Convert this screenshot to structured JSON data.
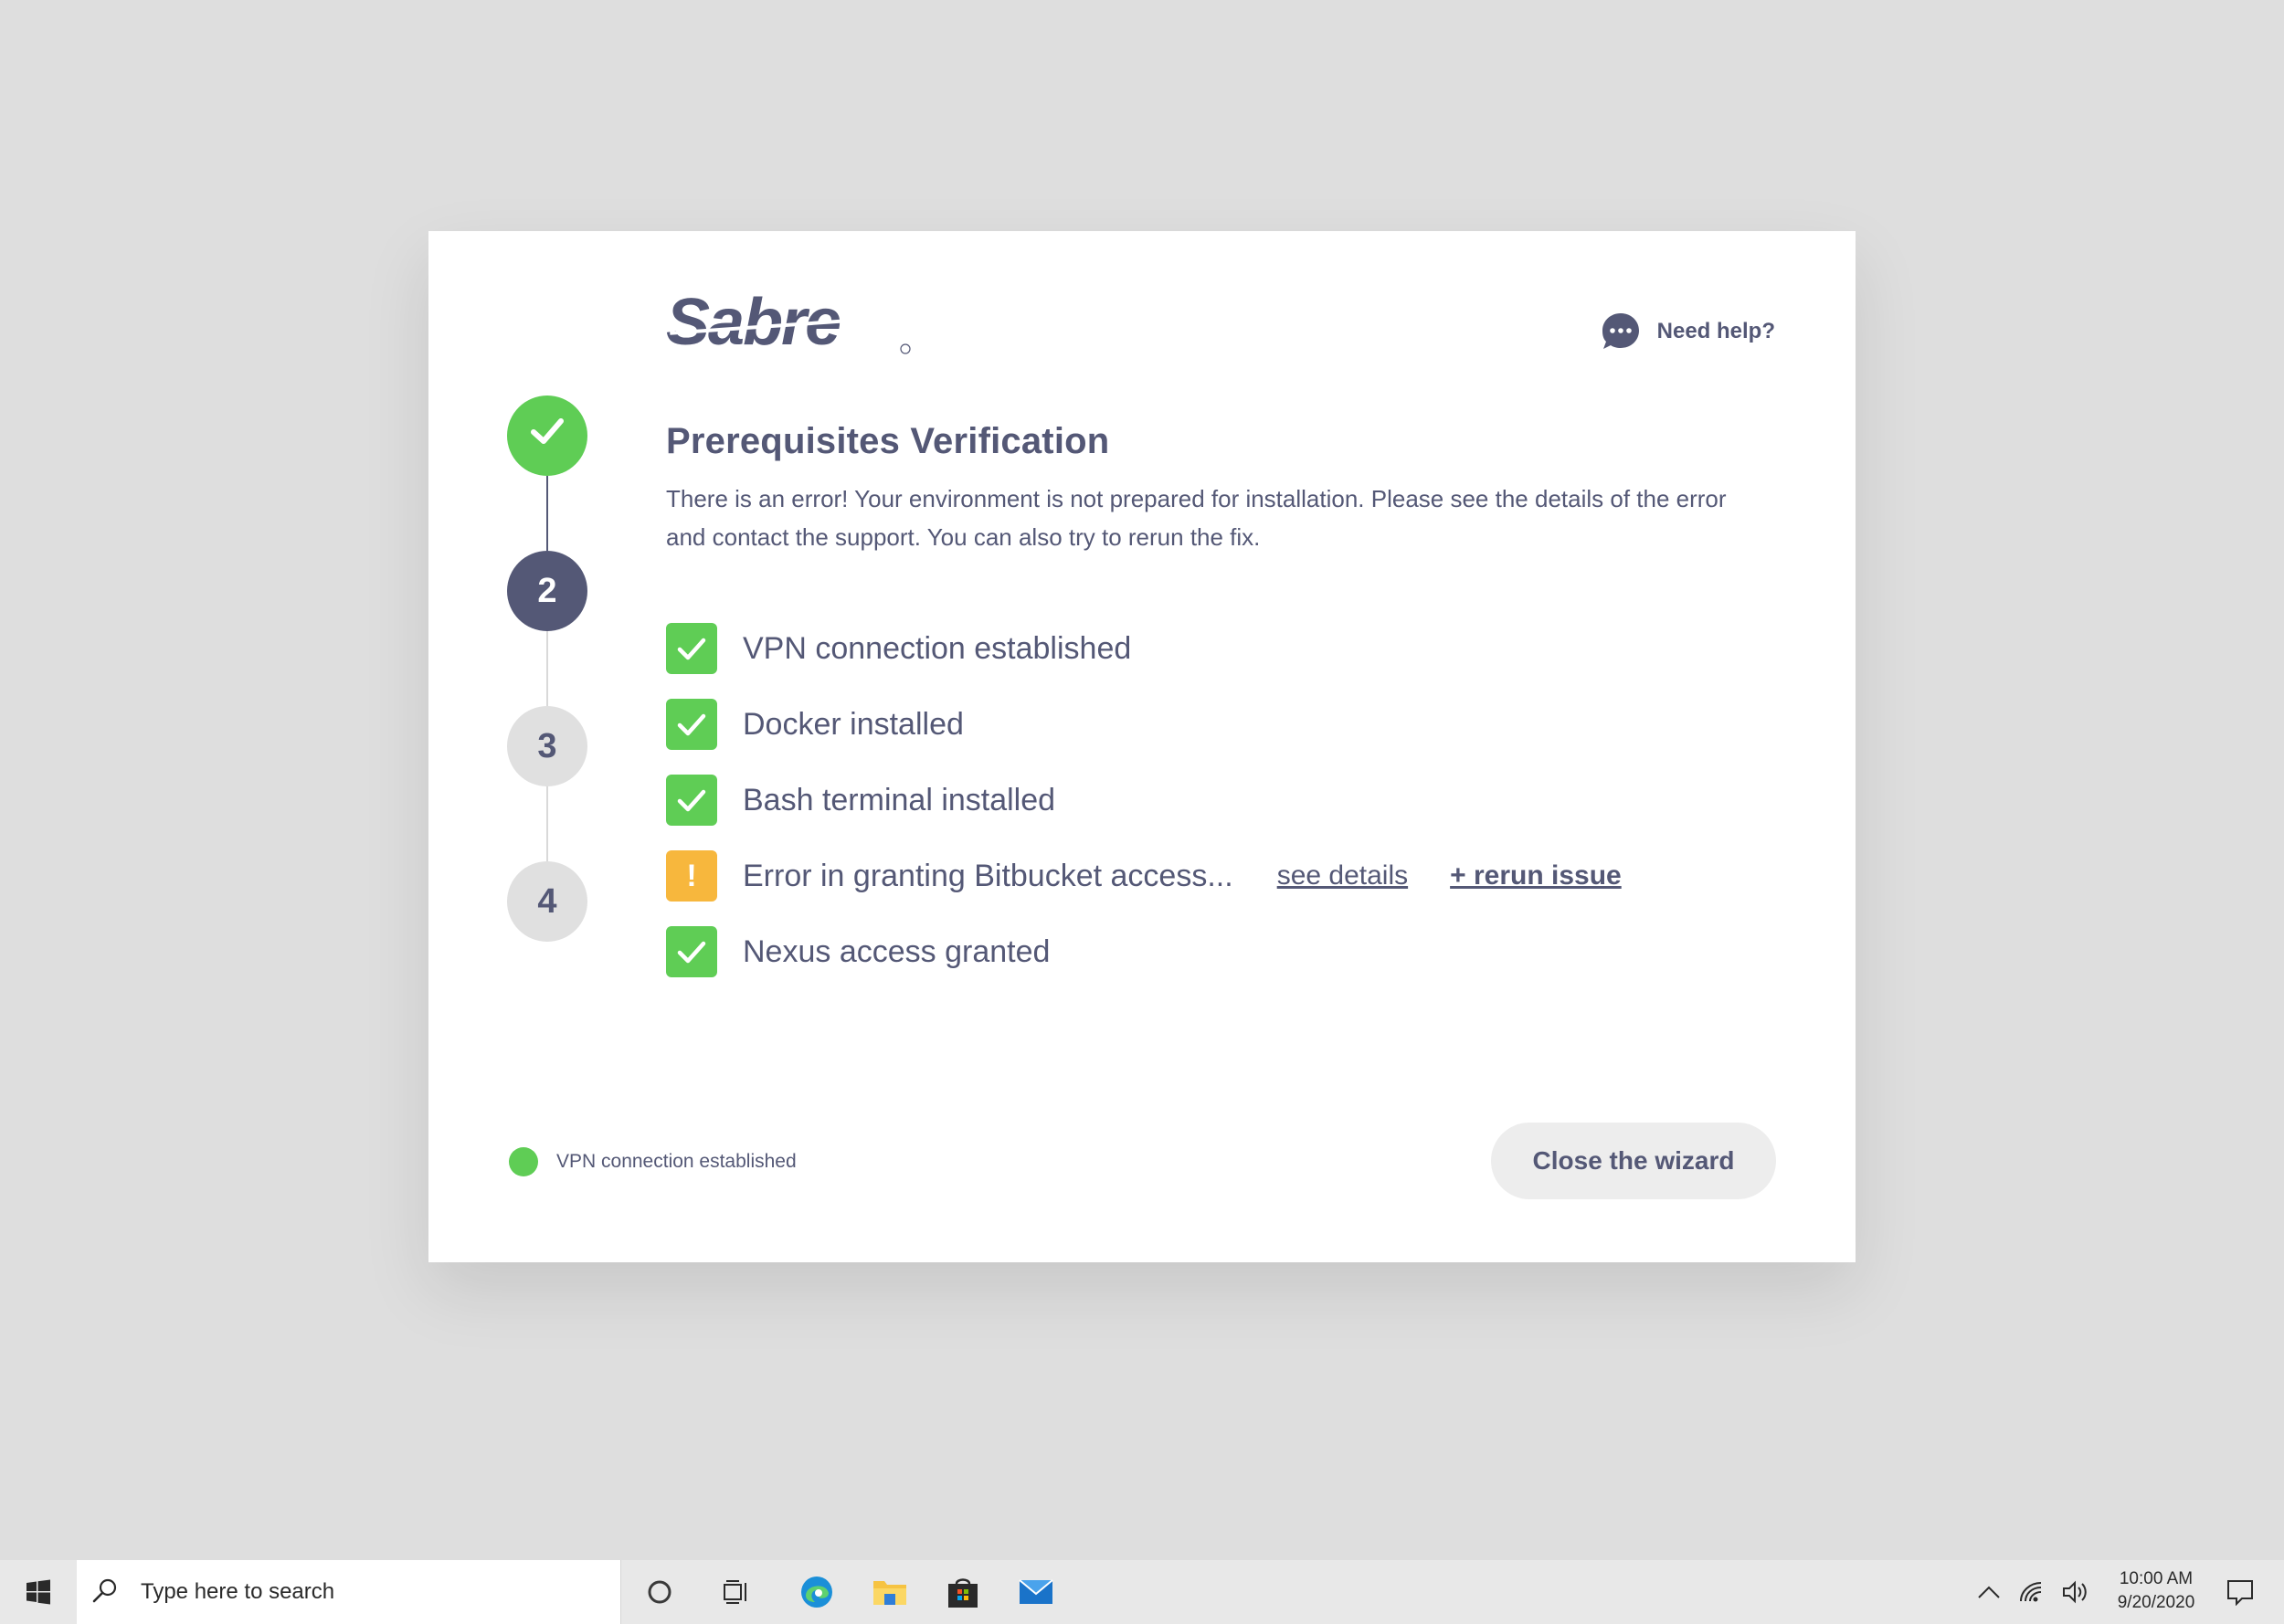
{
  "brand": {
    "logo_text": "Sabre"
  },
  "help": {
    "label": "Need help?"
  },
  "stepper": {
    "steps": [
      {
        "label": "",
        "state": "complete"
      },
      {
        "label": "2",
        "state": "active"
      },
      {
        "label": "3",
        "state": "pending"
      },
      {
        "label": "4",
        "state": "pending"
      }
    ]
  },
  "main": {
    "title": "Prerequisites Verification",
    "description": "There is an error! Your environment is not prepared for installation. Please see the details of the error and contact the support. You can also try to rerun the fix.",
    "checks": [
      {
        "label": "VPN connection established",
        "status": "ok"
      },
      {
        "label": "Docker installed",
        "status": "ok"
      },
      {
        "label": "Bash terminal installed",
        "status": "ok"
      },
      {
        "label": "Error in granting Bitbucket access...",
        "status": "warning",
        "warning_glyph": "!",
        "details_link": "see details",
        "rerun_link": "+ rerun issue"
      },
      {
        "label": "Nexus access granted",
        "status": "ok"
      }
    ]
  },
  "footer": {
    "status_text": "VPN connection established",
    "close_button": "Close the wizard"
  },
  "taskbar": {
    "search_placeholder": "Type here to search",
    "time": "10:00 AM",
    "date": "9/20/2020"
  },
  "colors": {
    "success": "#5fcd55",
    "warning": "#f7b73d",
    "primary_text": "#545876",
    "background": "#dedede"
  },
  "icons": {
    "help": "chat-bubble-icon",
    "check": "check-icon",
    "warning": "exclamation-icon"
  }
}
